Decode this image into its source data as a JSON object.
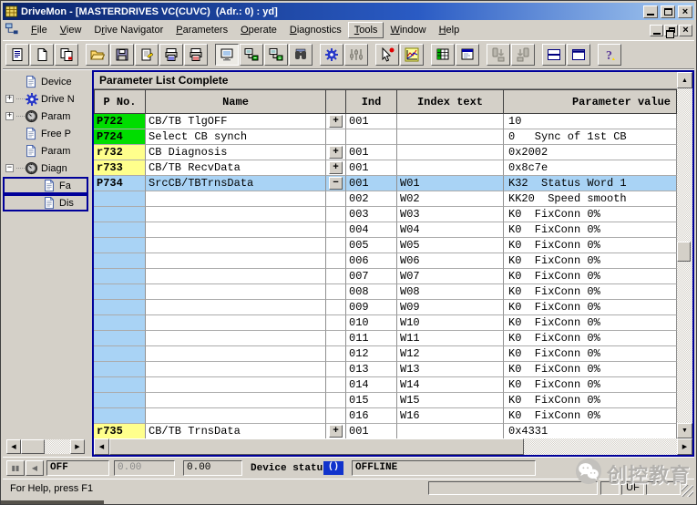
{
  "window": {
    "title": "DriveMon - [MASTERDRIVES VC(CUVC)  (Adr.: 0) : yd]"
  },
  "menubar": {
    "items": [
      {
        "pre": "",
        "key": "F",
        "post": "ile",
        "raised": false
      },
      {
        "pre": "",
        "key": "V",
        "post": "iew",
        "raised": false
      },
      {
        "pre": "D",
        "key": "r",
        "post": "ive Navigator",
        "raised": false
      },
      {
        "pre": "",
        "key": "P",
        "post": "arameters",
        "raised": false
      },
      {
        "pre": "",
        "key": "O",
        "post": "perate",
        "raised": false
      },
      {
        "pre": "",
        "key": "D",
        "post": "iagnostics",
        "raised": false
      },
      {
        "pre": "",
        "key": "T",
        "post": "ools",
        "raised": true
      },
      {
        "pre": "",
        "key": "W",
        "post": "indow",
        "raised": false
      },
      {
        "pre": "",
        "key": "H",
        "post": "elp",
        "raised": false
      }
    ]
  },
  "toolbar": {
    "buttons": [
      {
        "icon": "file-list-icon",
        "group": 1,
        "disabled": false,
        "pressed": false
      },
      {
        "icon": "new-file-icon",
        "group": 1,
        "disabled": false,
        "pressed": false
      },
      {
        "icon": "copy-files-icon",
        "group": 1,
        "disabled": false,
        "pressed": false
      },
      {
        "icon": "open-folder-icon",
        "group": 2,
        "disabled": false,
        "pressed": false
      },
      {
        "icon": "save-icon",
        "group": 2,
        "disabled": false,
        "pressed": false
      },
      {
        "icon": "properties-icon",
        "group": 2,
        "disabled": false,
        "pressed": false
      },
      {
        "icon": "print-icon",
        "group": 2,
        "disabled": false,
        "pressed": false
      },
      {
        "icon": "print-alt-icon",
        "group": 2,
        "disabled": false,
        "pressed": false
      },
      {
        "icon": "monitor-icon",
        "group": 3,
        "disabled": false,
        "pressed": true
      },
      {
        "icon": "net-node1-icon",
        "group": 3,
        "disabled": false,
        "pressed": false
      },
      {
        "icon": "net-node2-icon",
        "group": 3,
        "disabled": false,
        "pressed": false
      },
      {
        "icon": "binoculars-icon",
        "group": 3,
        "disabled": false,
        "pressed": false
      },
      {
        "icon": "gear-icon",
        "group": 4,
        "disabled": false,
        "pressed": false
      },
      {
        "icon": "sliders-icon",
        "group": 4,
        "disabled": true,
        "pressed": false
      },
      {
        "icon": "select-tool-icon",
        "group": 5,
        "disabled": false,
        "pressed": false
      },
      {
        "icon": "trace-chart-icon",
        "group": 5,
        "disabled": false,
        "pressed": false
      },
      {
        "icon": "table-icon",
        "group": 6,
        "disabled": false,
        "pressed": false
      },
      {
        "icon": "form-icon",
        "group": 6,
        "disabled": false,
        "pressed": false
      },
      {
        "icon": "download-icon",
        "group": 7,
        "disabled": true,
        "pressed": false
      },
      {
        "icon": "download-alt-icon",
        "group": 7,
        "disabled": true,
        "pressed": false
      },
      {
        "icon": "window-split-icon",
        "group": 8,
        "disabled": false,
        "pressed": false
      },
      {
        "icon": "window-full-icon",
        "group": 8,
        "disabled": false,
        "pressed": false
      },
      {
        "icon": "help-icon",
        "group": 9,
        "disabled": false,
        "pressed": false
      }
    ]
  },
  "sidebar": {
    "items": [
      {
        "label": "Device",
        "icon": "document-icon",
        "expand": null,
        "child": false
      },
      {
        "label": "Drive N",
        "icon": "gear-icon",
        "expand": "+",
        "child": false
      },
      {
        "label": "Param",
        "icon": "gauge-icon",
        "expand": "+",
        "child": false
      },
      {
        "label": "Free P",
        "icon": "document-icon",
        "expand": null,
        "child": false
      },
      {
        "label": "Param",
        "icon": "document-icon",
        "expand": null,
        "child": false
      },
      {
        "label": "Diagn",
        "icon": "gauge-icon",
        "expand": "-",
        "child": false
      },
      {
        "label": "Fa",
        "icon": "document-icon",
        "expand": null,
        "child": true
      },
      {
        "label": "Dis",
        "icon": "document-icon",
        "expand": null,
        "child": true
      }
    ]
  },
  "child_window": {
    "title": "Parameter List Complete"
  },
  "table": {
    "headers": {
      "pno": "P No.",
      "name": "Name",
      "expand": "",
      "ind": "Ind",
      "index_text": "Index text",
      "value": "Parameter value"
    },
    "rows": [
      {
        "pno": "P722",
        "pno_style": "green",
        "name": "CB/TB TlgOFF",
        "expand": "+",
        "ind": "001",
        "index_text": "",
        "value": "10",
        "selected": false
      },
      {
        "pno": "P724",
        "pno_style": "green",
        "name": "Select CB synch",
        "expand": "",
        "ind": "",
        "index_text": "",
        "value": "0   Sync of 1st CB",
        "selected": false
      },
      {
        "pno": "r732",
        "pno_style": "yellow",
        "name": "CB Diagnosis",
        "expand": "+",
        "ind": "001",
        "index_text": "",
        "value": "0x2002",
        "selected": false
      },
      {
        "pno": "r733",
        "pno_style": "yellow",
        "name": "CB/TB RecvData",
        "expand": "+",
        "ind": "001",
        "index_text": "",
        "value": "0x8c7e",
        "selected": false
      },
      {
        "pno": "P734",
        "pno_style": "blue",
        "name": "SrcCB/TBTrnsData",
        "expand": "-",
        "ind": "001",
        "index_text": "W01",
        "value": "K32  Status Word 1",
        "selected": true
      },
      {
        "pno": "",
        "pno_style": "blue",
        "name": "",
        "expand": "",
        "ind": "002",
        "index_text": "W02",
        "value": "KK20  Speed smooth",
        "selected": false
      },
      {
        "pno": "",
        "pno_style": "blue",
        "name": "",
        "expand": "",
        "ind": "003",
        "index_text": "W03",
        "value": "K0  FixConn 0%",
        "selected": false
      },
      {
        "pno": "",
        "pno_style": "blue",
        "name": "",
        "expand": "",
        "ind": "004",
        "index_text": "W04",
        "value": "K0  FixConn 0%",
        "selected": false
      },
      {
        "pno": "",
        "pno_style": "blue",
        "name": "",
        "expand": "",
        "ind": "005",
        "index_text": "W05",
        "value": "K0  FixConn 0%",
        "selected": false
      },
      {
        "pno": "",
        "pno_style": "blue",
        "name": "",
        "expand": "",
        "ind": "006",
        "index_text": "W06",
        "value": "K0  FixConn 0%",
        "selected": false
      },
      {
        "pno": "",
        "pno_style": "blue",
        "name": "",
        "expand": "",
        "ind": "007",
        "index_text": "W07",
        "value": "K0  FixConn 0%",
        "selected": false
      },
      {
        "pno": "",
        "pno_style": "blue",
        "name": "",
        "expand": "",
        "ind": "008",
        "index_text": "W08",
        "value": "K0  FixConn 0%",
        "selected": false
      },
      {
        "pno": "",
        "pno_style": "blue",
        "name": "",
        "expand": "",
        "ind": "009",
        "index_text": "W09",
        "value": "K0  FixConn 0%",
        "selected": false
      },
      {
        "pno": "",
        "pno_style": "blue",
        "name": "",
        "expand": "",
        "ind": "010",
        "index_text": "W10",
        "value": "K0  FixConn 0%",
        "selected": false
      },
      {
        "pno": "",
        "pno_style": "blue",
        "name": "",
        "expand": "",
        "ind": "011",
        "index_text": "W11",
        "value": "K0  FixConn 0%",
        "selected": false
      },
      {
        "pno": "",
        "pno_style": "blue",
        "name": "",
        "expand": "",
        "ind": "012",
        "index_text": "W12",
        "value": "K0  FixConn 0%",
        "selected": false
      },
      {
        "pno": "",
        "pno_style": "blue",
        "name": "",
        "expand": "",
        "ind": "013",
        "index_text": "W13",
        "value": "K0  FixConn 0%",
        "selected": false
      },
      {
        "pno": "",
        "pno_style": "blue",
        "name": "",
        "expand": "",
        "ind": "014",
        "index_text": "W14",
        "value": "K0  FixConn 0%",
        "selected": false
      },
      {
        "pno": "",
        "pno_style": "blue",
        "name": "",
        "expand": "",
        "ind": "015",
        "index_text": "W15",
        "value": "K0  FixConn 0%",
        "selected": false
      },
      {
        "pno": "",
        "pno_style": "blue",
        "name": "",
        "expand": "",
        "ind": "016",
        "index_text": "W16",
        "value": "K0  FixConn 0%",
        "selected": false
      },
      {
        "pno": "r735",
        "pno_style": "yellow",
        "name": "CB/TB TrnsData",
        "expand": "+",
        "ind": "001",
        "index_text": "",
        "value": "0x4331",
        "selected": false
      }
    ]
  },
  "controlbar": {
    "run_state": "OFF",
    "value1": "0.00",
    "value2": "0.00",
    "device_status_label": "Device status",
    "indicator": "()",
    "connection": "OFFLINE"
  },
  "statusbar": {
    "help": "For Help, press F1",
    "uf": "UF"
  },
  "watermark": {
    "text": "创控教育"
  },
  "colors": {
    "titlebar_start": "#0a246a",
    "titlebar_end": "#a6caf0",
    "chrome_gray": "#d4d0c8",
    "row_green": "#00dd00",
    "row_yellow": "#ffff8c",
    "row_selected_blue": "#a9d3f5",
    "child_border_blue": "#000099",
    "indicator_blue": "#1133cc"
  }
}
